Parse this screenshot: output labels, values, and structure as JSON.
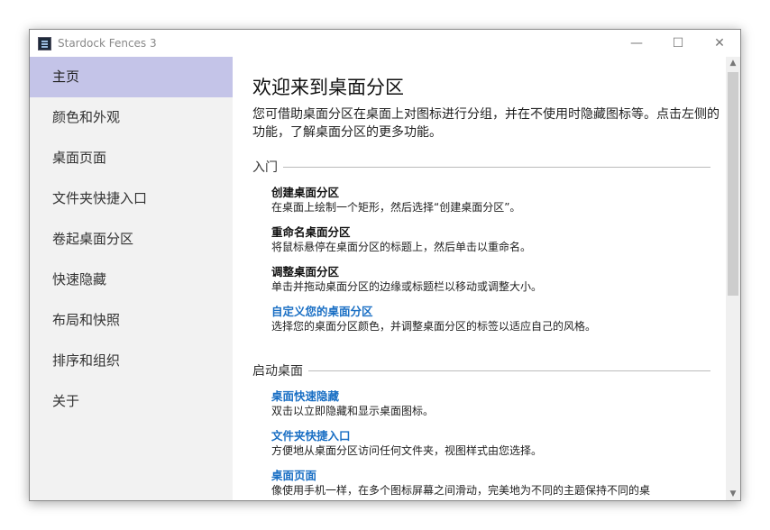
{
  "window": {
    "title": "Stardock Fences 3",
    "minimize": "—",
    "maximize": "☐",
    "close": "✕"
  },
  "sidebar": {
    "items": [
      {
        "label": "主页"
      },
      {
        "label": "颜色和外观"
      },
      {
        "label": "桌面页面"
      },
      {
        "label": "文件夹快捷入口"
      },
      {
        "label": "卷起桌面分区"
      },
      {
        "label": "快速隐藏"
      },
      {
        "label": "布局和快照"
      },
      {
        "label": "排序和组织"
      },
      {
        "label": "关于"
      }
    ]
  },
  "main": {
    "title": "欢迎来到桌面分区",
    "intro": "您可借助桌面分区在桌面上对图标进行分组，并在不使用时隐藏图标等。点击左侧的功能，了解桌面分区的更多功能。",
    "sections": [
      {
        "title": "入门",
        "items": [
          {
            "heading": "创建桌面分区",
            "desc": "在桌面上绘制一个矩形，然后选择“创建桌面分区”。"
          },
          {
            "heading": "重命名桌面分区",
            "desc": "将鼠标悬停在桌面分区的标题上，然后单击以重命名。"
          },
          {
            "heading": "调整桌面分区",
            "desc": "单击并拖动桌面分区的边缘或标题栏以移动或调整大小。"
          },
          {
            "heading": "自定义您的桌面分区",
            "desc": "选择您的桌面分区颜色，并调整桌面分区的标签以适应自己的风格。"
          }
        ]
      },
      {
        "title": "启动桌面",
        "items": [
          {
            "heading": "桌面快速隐藏",
            "desc": "双击以立即隐藏和显示桌面图标。"
          },
          {
            "heading": "文件夹快捷入口",
            "desc": "方便地从桌面分区访问任何文件夹，视图样式由您选择。"
          },
          {
            "heading": "桌面页面",
            "desc": "像使用手机一样，在多个图标屏幕之间滑动，完美地为不同的主题保持不同的桌"
          }
        ]
      }
    ]
  },
  "colors": {
    "accent": "#c4c4e8",
    "link": "#1a6fc4"
  }
}
